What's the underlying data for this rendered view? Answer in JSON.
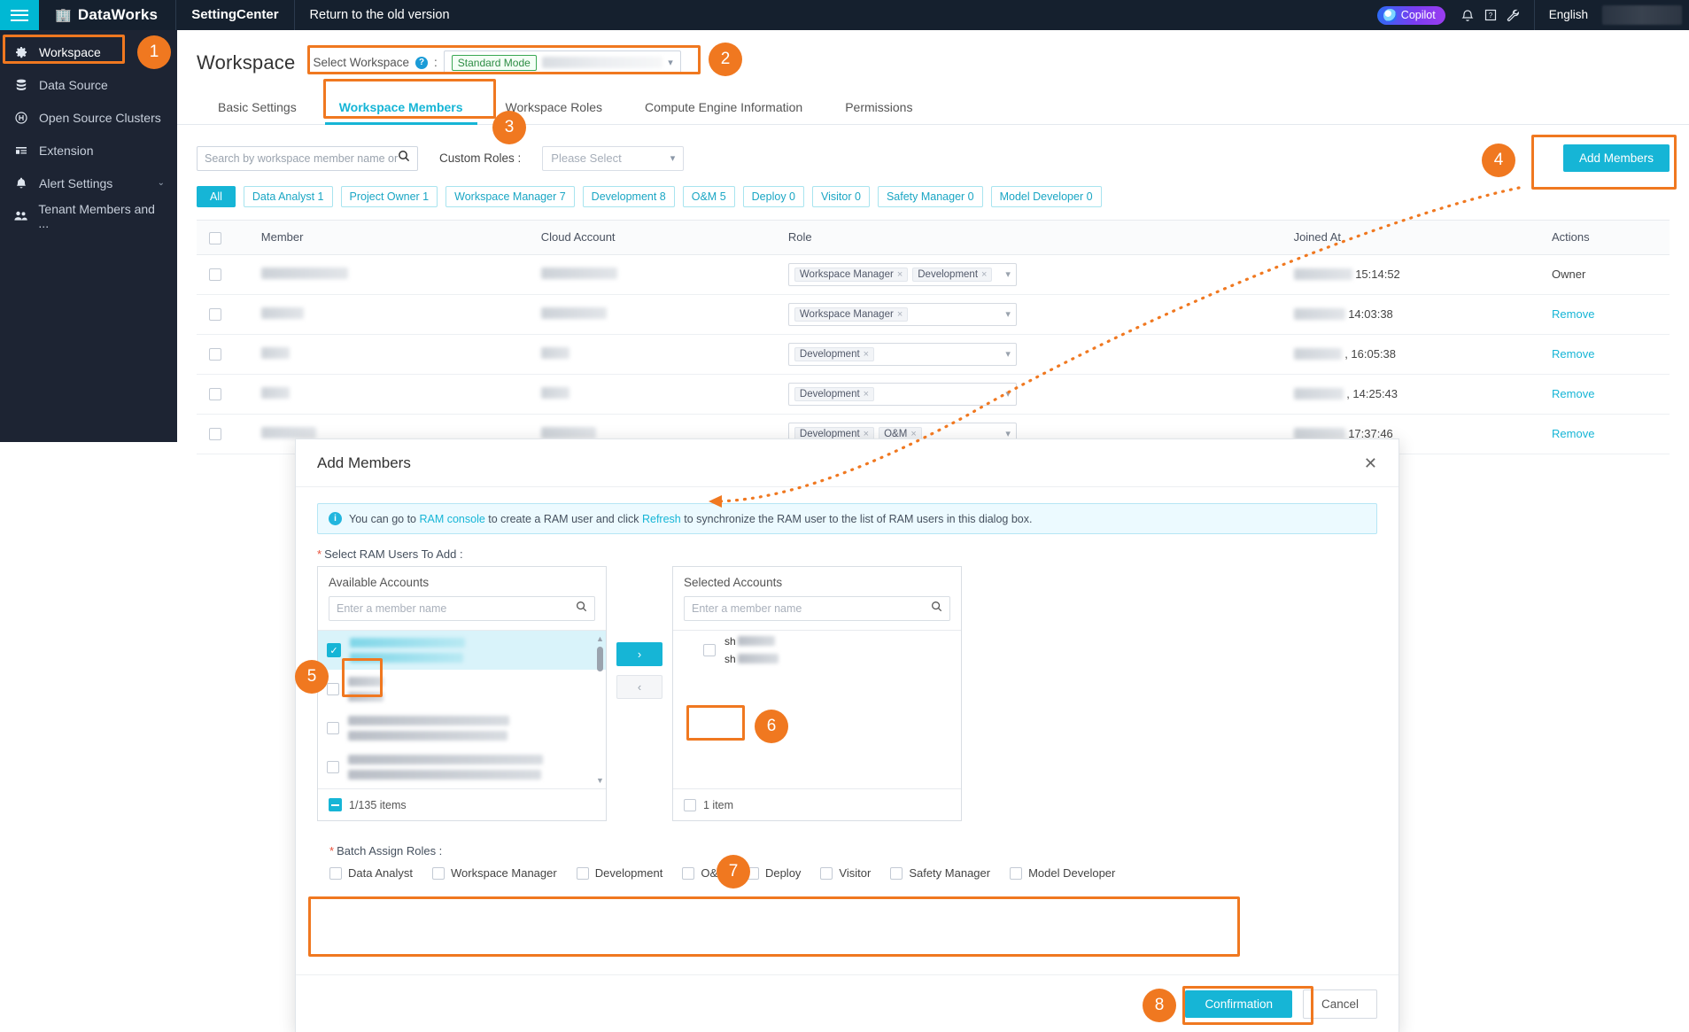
{
  "topnav": {
    "menu_icon": "hamburger-icon",
    "brand": "DataWorks",
    "product": "SettingCenter",
    "return_link": "Return to the old version",
    "copilot": "Copilot",
    "bell_icon": "bell-icon",
    "help_icon": "help-icon",
    "wrench_icon": "wrench-icon",
    "language": "English"
  },
  "sidebar": {
    "items": [
      {
        "label": "Workspace",
        "icon": "gear-icon",
        "active": true,
        "caret": ""
      },
      {
        "label": "Data Source",
        "icon": "database-icon",
        "active": false,
        "caret": ""
      },
      {
        "label": "Open Source Clusters",
        "icon": "hadoop-icon",
        "active": false,
        "caret": ""
      },
      {
        "label": "Extension",
        "icon": "extension-icon",
        "active": false,
        "caret": ""
      },
      {
        "label": "Alert Settings",
        "icon": "alert-bell-icon",
        "active": false,
        "caret": "⌄"
      },
      {
        "label": "Tenant Members and ...",
        "icon": "users-icon",
        "active": false,
        "caret": ""
      }
    ]
  },
  "page": {
    "title": "Workspace",
    "select_workspace_label": "Select Workspace",
    "select_workspace_colon": ":",
    "workspace_mode_tag": "Standard Mode",
    "help_icon": "help-circle-icon"
  },
  "tabs": [
    {
      "label": "Basic Settings",
      "active": false
    },
    {
      "label": "Workspace Members",
      "active": true
    },
    {
      "label": "Workspace Roles",
      "active": false
    },
    {
      "label": "Compute Engine Information",
      "active": false
    },
    {
      "label": "Permissions",
      "active": false
    }
  ],
  "toolbar": {
    "search_placeholder": "Search by workspace member name or Alibaba Cloud account",
    "search_value": "",
    "search_icon": "search-icon",
    "custom_roles_label": "Custom Roles :",
    "custom_roles_value": "Please Select",
    "add_members_label": "Add Members"
  },
  "chips": [
    {
      "label": "All",
      "selected": true
    },
    {
      "label": "Data Analyst 1",
      "selected": false
    },
    {
      "label": "Project Owner 1",
      "selected": false
    },
    {
      "label": "Workspace Manager 7",
      "selected": false
    },
    {
      "label": "Development 8",
      "selected": false
    },
    {
      "label": "O&M 5",
      "selected": false
    },
    {
      "label": "Deploy 0",
      "selected": false
    },
    {
      "label": "Visitor 0",
      "selected": false
    },
    {
      "label": "Safety Manager 0",
      "selected": false
    },
    {
      "label": "Model Developer 0",
      "selected": false
    }
  ],
  "table": {
    "columns": [
      "Member",
      "Cloud Account",
      "Role",
      "Joined At",
      "Actions"
    ],
    "rows": [
      {
        "roles": [
          "Workspace Manager",
          "Development"
        ],
        "joined": "15:14:52",
        "action": "Owner"
      },
      {
        "roles": [
          "Workspace Manager"
        ],
        "joined": "14:03:38",
        "action": "Remove"
      },
      {
        "roles": [
          "Development"
        ],
        "joined": ", 16:05:38",
        "action": "Remove"
      },
      {
        "roles": [
          "Development"
        ],
        "joined": ", 14:25:43",
        "action": "Remove"
      },
      {
        "roles": [
          "Development",
          "O&M"
        ],
        "joined": "17:37:46",
        "action": "Remove"
      }
    ]
  },
  "dialog": {
    "title": "Add Members",
    "close_icon": "close-icon",
    "info": {
      "icon": "info-icon",
      "part1": "You can go to ",
      "link1": "RAM console",
      "part2": " to create a RAM user and click ",
      "link2": "Refresh",
      "part3": " to synchronize the RAM user to the list of RAM users in this dialog box."
    },
    "select_users_label": "Select RAM Users To Add :",
    "available": {
      "title": "Available Accounts",
      "search_placeholder": "Enter a member name",
      "search_value": "",
      "footer_count": "1/135 items"
    },
    "selected": {
      "title": "Selected Accounts",
      "search_placeholder": "Enter a member name",
      "search_value": "",
      "item_prefix": "sh",
      "footer_count": "1 item"
    },
    "move_right_icon": "chevron-right-icon",
    "move_left_icon": "chevron-left-icon",
    "batch_label": "Batch Assign Roles :",
    "batch_roles": [
      "Data Analyst",
      "Workspace Manager",
      "Development",
      "O&M",
      "Deploy",
      "Visitor",
      "Safety Manager",
      "Model Developer"
    ],
    "confirm_label": "Confirmation",
    "cancel_label": "Cancel"
  },
  "annotations": {
    "badges": [
      "1",
      "2",
      "3",
      "4",
      "5",
      "6",
      "7",
      "8"
    ],
    "highlight_color": "#f07820"
  }
}
